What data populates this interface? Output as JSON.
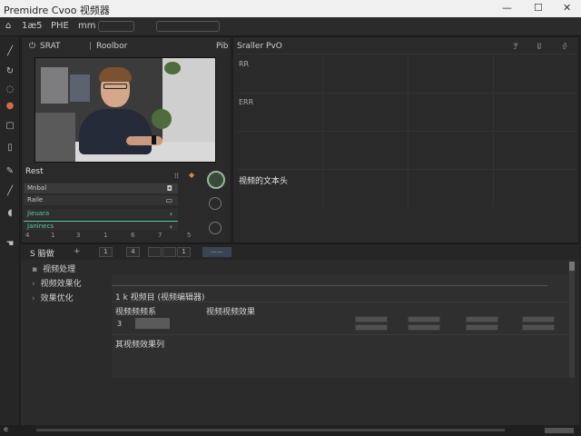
{
  "window": {
    "title": "Premidre Cvoo 视频器",
    "minimize": "—",
    "maximize": "☐",
    "close": "✕"
  },
  "menu": {
    "items": [
      "1æ5",
      "PHE",
      "mm"
    ]
  },
  "source_panel": {
    "tab1": "SRAT",
    "tab2": "Roolbor",
    "tab3": "Pib",
    "list_header": "Rest",
    "rows": [
      {
        "label": "Mnbal",
        "value": "◘",
        "color": "#c8c8c8"
      },
      {
        "label": "Raile",
        "value": "▭",
        "color": "#c8c8c8"
      },
      {
        "label": "Jieuara",
        "value": "›",
        "color": "#5ec7a8"
      },
      {
        "label": "Janinecs",
        "value": "›",
        "color": "#5ec7a8"
      }
    ],
    "ruler_ticks": [
      "4",
      "1",
      "3",
      "1",
      "6",
      "7",
      "5"
    ]
  },
  "program_panel": {
    "tab": "Sraller PvO",
    "grid_label1": "RR",
    "grid_label2": "ERR",
    "caption": "视频的文本头",
    "header_icons": [
      "ꂖ",
      "ꀂ",
      "ꀆ"
    ]
  },
  "timeline_bar": {
    "label": "S 脑做",
    "plus": "+",
    "buttons": [
      "1",
      "4",
      "",
      "",
      "1"
    ],
    "badge": "——"
  },
  "effects": {
    "tree": [
      "视频处理",
      "视频效果化",
      "效果优化"
    ],
    "detail_header": "1 k 视频目 (视频编辑器)",
    "row_label1": "视频频频系",
    "row_label2": "视频视频效果",
    "row_num": "3",
    "row_label3": "其视频效果列"
  },
  "statusbar": {
    "left": "e"
  }
}
